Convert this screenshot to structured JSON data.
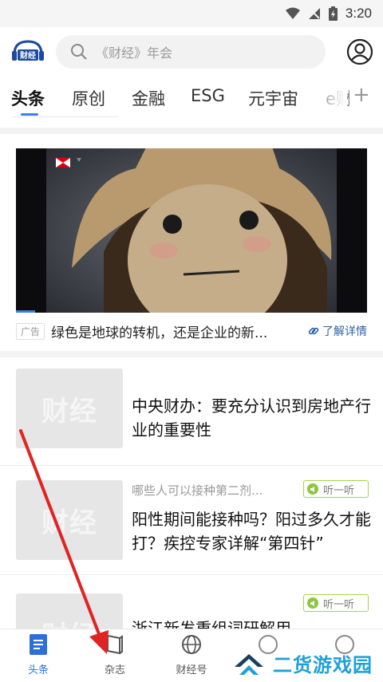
{
  "status_bar": {
    "time": "3:20"
  },
  "header": {
    "logo_text": "财经",
    "search_placeholder": "《财经》年会"
  },
  "tabs": [
    {
      "label": "头条",
      "active": true
    },
    {
      "label": "原创",
      "active": false
    },
    {
      "label": "金融",
      "active": false
    },
    {
      "label": "ESG",
      "active": false
    },
    {
      "label": "元宇宙",
      "active": false
    },
    {
      "label": "e财",
      "active": false
    }
  ],
  "ad": {
    "badge": "广告",
    "title": "绿色是地球的转机，还是企业的新...",
    "detail_label": "了解详情"
  },
  "news": [
    {
      "thumb_text": "财经",
      "title": "中央财办：要充分认识到房地产行业的重要性"
    },
    {
      "thumb_text": "财经",
      "subtitle": "哪些人可以接种第二剂...",
      "listen_label": "听一听",
      "title": "阳性期间能接种吗？阳过多久才能打？疾控专家详解“第四针”"
    },
    {
      "thumb_text": "财经",
      "listen_label": "听一听",
      "title": "浙江新发重组词研解用..."
    }
  ],
  "bottom_nav": [
    {
      "label": "头条",
      "icon": "document-icon",
      "active": true
    },
    {
      "label": "杂志",
      "icon": "magazine-icon",
      "active": false
    },
    {
      "label": "财经号",
      "icon": "globe-icon",
      "active": false
    },
    {
      "label": "",
      "icon": "circle-icon",
      "active": false
    },
    {
      "label": "",
      "icon": "circle-icon",
      "active": false
    }
  ],
  "watermark": {
    "text": "二货游戏园"
  },
  "colors": {
    "accent": "#2d6fd6",
    "tab_underline": "#3c7fe0",
    "listen_green": "#8cc63f",
    "arrow_red": "#e02424",
    "watermark_blue": "#1fa0d8"
  }
}
